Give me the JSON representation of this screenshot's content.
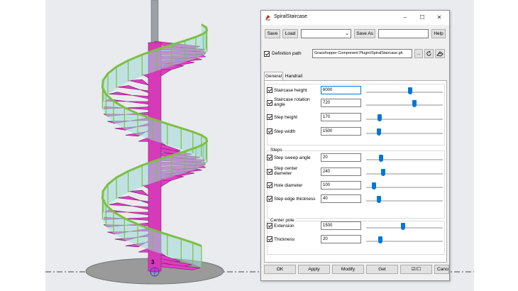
{
  "dialog": {
    "title": "SpiralStaircase",
    "window_controls": {
      "minimize": "–",
      "maximize": "☐",
      "close": "✕"
    },
    "toolbar": {
      "save": "Save",
      "load": "Load",
      "preset_value": "",
      "save_as": "Save As",
      "save_as_value": "",
      "help": "Help"
    },
    "definition": {
      "label": "Definition path",
      "checked": true,
      "value": "Grasshopper Component Plugin\\SpiralStaircase.gh",
      "browse": "..."
    },
    "tabs": [
      "General",
      "Handrail"
    ],
    "groups": {
      "steps": "Steps",
      "center_pole": "Center pole"
    },
    "params": [
      {
        "label": "Staircase height",
        "value": "6000",
        "checked": true,
        "slider": 0.58
      },
      {
        "label": "Staircase rotation angle",
        "value": "720",
        "checked": true,
        "slider": 0.64
      },
      {
        "label": "Step height",
        "value": "170",
        "checked": true,
        "slider": 0.16
      },
      {
        "label": "Step width",
        "value": "1500",
        "checked": true,
        "slider": 0.15
      },
      {
        "label": "Step sweep angle",
        "value": "20",
        "checked": true,
        "slider": 0.18
      },
      {
        "label": "Step center diameter",
        "value": "240",
        "checked": true,
        "slider": 0.21
      },
      {
        "label": "Hole diameter",
        "value": "100",
        "checked": true,
        "slider": 0.08
      },
      {
        "label": "Step edge thickness",
        "value": "40",
        "checked": true,
        "slider": 0.15
      },
      {
        "label": "Extension",
        "value": "1500",
        "checked": true,
        "slider": 0.48
      },
      {
        "label": "Thickness",
        "value": "20",
        "checked": true,
        "slider": 0.17
      }
    ],
    "buttons": {
      "ok": "OK",
      "apply": "Apply",
      "modify": "Modify",
      "get": "Get",
      "toggle": "☑/☐",
      "cancel": "Cancel"
    }
  },
  "model": {
    "marker_label": "3"
  },
  "colors": {
    "pole": "#d63ab8",
    "steps": "#e03ec4",
    "railing": "#7cc043",
    "glass": "#9fd8d8",
    "base": "#9a9a9a",
    "accent": "#0078d7"
  }
}
